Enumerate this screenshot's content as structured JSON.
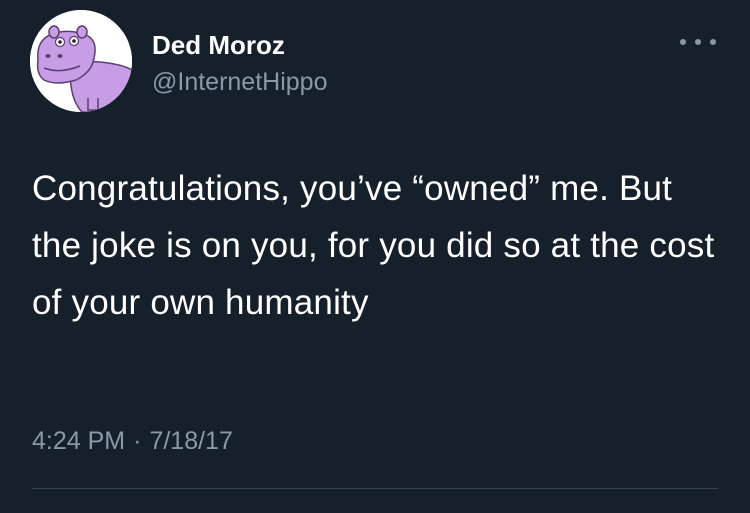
{
  "tweet": {
    "author": {
      "display_name": "Ded Moroz",
      "handle": "@InternetHippo",
      "avatar_icon": "hippo-avatar-icon"
    },
    "text": "Congratulations, you’ve “owned” me. But the joke is on you, for you did so at the cost of your own humanity",
    "time": "4:24 PM",
    "separator": "·",
    "date": "7/18/17",
    "more_icon": "more-options-icon"
  },
  "colors": {
    "background": "#15202b",
    "primary_text": "#ffffff",
    "secondary_text": "#8b98a5",
    "avatar_hippo": "#c79de6",
    "divider": "#38444d"
  }
}
